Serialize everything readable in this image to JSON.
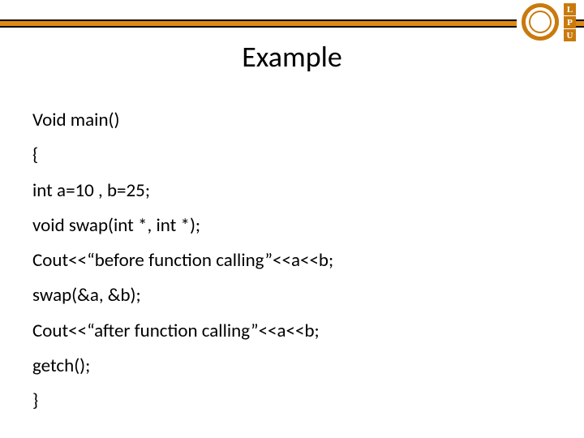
{
  "title": "Example",
  "logo": {
    "l": "L",
    "p": "P",
    "u": "U"
  },
  "code": {
    "l1": "Void main()",
    "l2": "{",
    "l3": "int a=10 , b=25;",
    "l4": "void swap(int *, int *);",
    "l5": "Cout<<“before function calling”<<a<<b;",
    "l6": "swap(&a, &b);",
    "l7": "Cout<<“after function calling”<<a<<b;",
    "l8": "getch();",
    "l9": "}"
  }
}
